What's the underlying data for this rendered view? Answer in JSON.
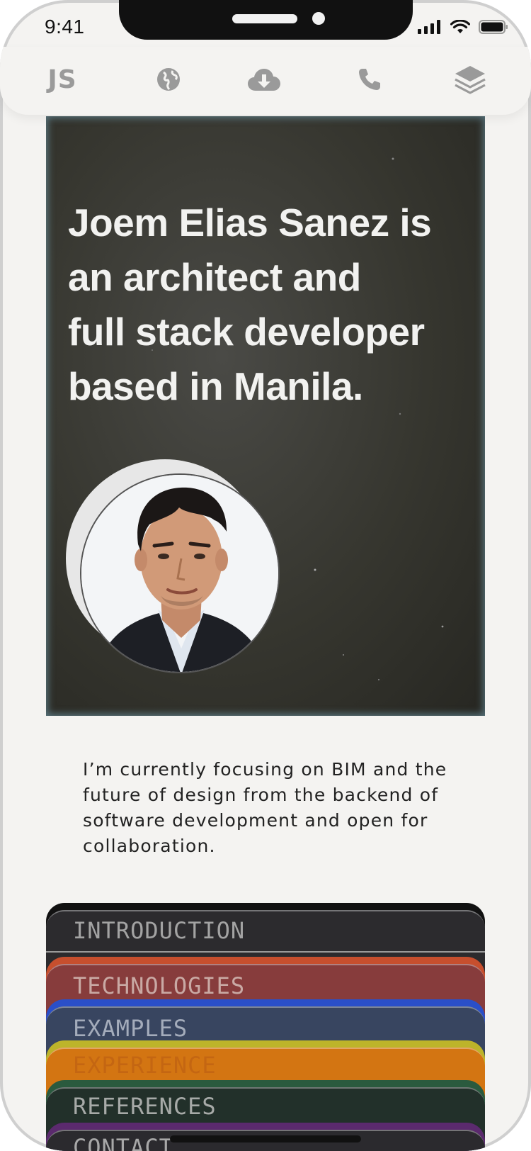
{
  "status_bar": {
    "time": "9:41"
  },
  "nav": {
    "logo": "JS",
    "items": [
      {
        "icon": "globe-icon"
      },
      {
        "icon": "cloud-download-icon"
      },
      {
        "icon": "phone-icon"
      },
      {
        "icon": "layers-icon"
      }
    ]
  },
  "hero": {
    "headline": "Joem Elias Sanez is\nan architect and\nfull  stack developer\nbased in Manila.",
    "avatar": "profile-photo"
  },
  "intro": {
    "text": "I’m currently focusing on BIM and the future of design from the backend of software development and open for collaboration."
  },
  "tabs": [
    {
      "label": "INTRODUCTION",
      "color": "#2c2b2e",
      "label_color": "#a3a3a3"
    },
    {
      "label": "TECHNOLOGIES",
      "color": "#873c3c",
      "label_color": "#c9a9a4"
    },
    {
      "label": "EXAMPLES",
      "color": "#384560",
      "label_color": "#a4acbb"
    },
    {
      "label": "EXPERIENCE",
      "color": "#d37512",
      "label_color": "#c46612"
    },
    {
      "label": "REFERENCES",
      "color": "#22302a",
      "label_color": "#a7aaa8"
    },
    {
      "label": "CONTACT",
      "color": "#2b2a2e",
      "label_color": "#a8a8a8"
    }
  ],
  "colors": {
    "background": "#f4f3f1",
    "hero_bg": "#36362f",
    "hero_text": "#f2f2f0",
    "nav_icon": "#9a9a9a"
  }
}
